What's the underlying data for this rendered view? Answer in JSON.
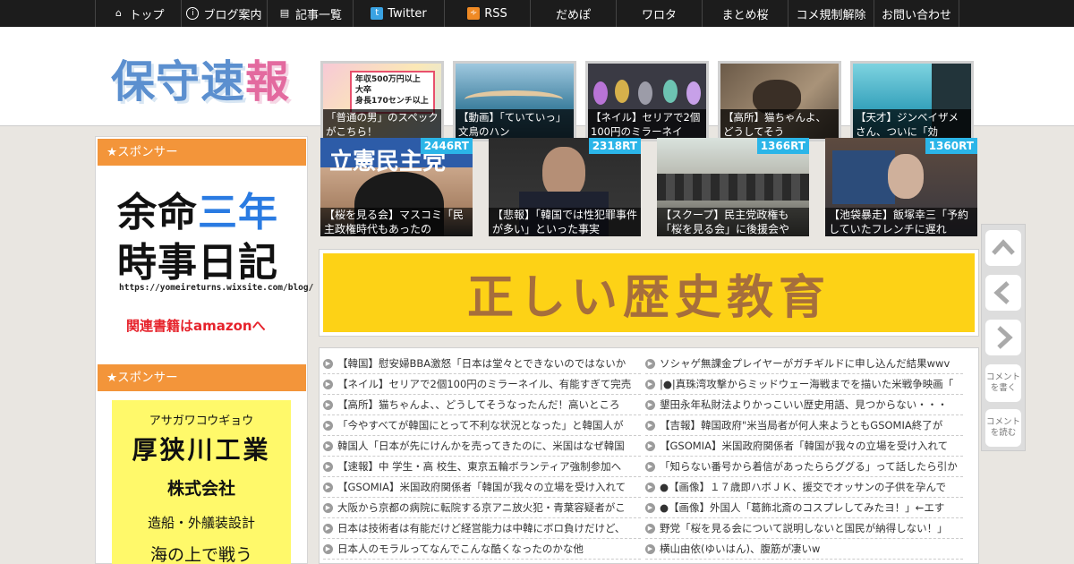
{
  "nav": {
    "items": [
      {
        "label": "トップ",
        "icon": "home-icon"
      },
      {
        "label": "ブログ案内",
        "icon": "info-icon"
      },
      {
        "label": "記事一覧",
        "icon": "list-icon"
      },
      {
        "label": "Twitter",
        "icon": "twitter-icon"
      },
      {
        "label": "RSS",
        "icon": "rss-icon"
      },
      {
        "label": "だめぽ"
      },
      {
        "label": "ワロタ"
      },
      {
        "label": "まとめ桜"
      },
      {
        "label": "コメ規制解除"
      },
      {
        "label": "お問い合わせ"
      }
    ]
  },
  "logo": {
    "text_blue": "保守速",
    "text_pink": "報"
  },
  "header_thumbs": [
    {
      "caption": "「普通の男」のスペックがこちら！",
      "badge_text": "年収500万円以上\n大卒\n身長170センチ以上"
    },
    {
      "caption": "【動画】「ていていっ」文鳥のハン"
    },
    {
      "caption": "【ネイル】セリアで2個100円のミラーネイ"
    },
    {
      "caption": "【高所】猫ちゃんよ、 どうしてそう"
    },
    {
      "caption": "【天才】ジンベイザメさん、ついに「効"
    }
  ],
  "sidebar": {
    "sponsor1_header": "★スポンサー",
    "ad1": {
      "line1a": "余命",
      "line1b": "三年",
      "line2": "時事日記",
      "url": "https://yomeireturns.wixsite.com/blog/",
      "amazon": "関連書籍はamazonへ"
    },
    "sponsor2_header": "★スポンサー",
    "ad2": {
      "kana": "アサガワコウギョウ",
      "name": "厚狭川工業",
      "corp": "株式会社",
      "desc": "造船・外艤装設計",
      "extra": "海の上で戦う"
    }
  },
  "featured": [
    {
      "rt": "2446RT",
      "caption": "【桜を見る会】マスコミ「民主政権時代もあったの"
    },
    {
      "rt": "2318RT",
      "caption": "【悲報】「韓国では性犯罪事件が多い」といった事実"
    },
    {
      "rt": "1366RT",
      "caption": "【スクープ】民主党政権も「桜を見る会」に後援会や"
    },
    {
      "rt": "1360RT",
      "caption": "【池袋暴走】飯塚幸三「予約していたフレンチに遅れ"
    }
  ],
  "banner": {
    "text": "正しい歴史教育"
  },
  "list_left": [
    "【韓国】慰安婦BBA激怒「日本は堂々とできないのではないか",
    "【ネイル】セリアで2個100円のミラーネイル、有能すぎて完売",
    "【高所】猫ちゃんよ、、どうしてそうなったんだ！高いところ",
    "「今やすべてが韓国にとって不利な状況となった」と韓国人が",
    "韓国人「日本が先にけんかを売ってきたのに、米国はなぜ韓国",
    "【速報】中 学生・高 校生、東京五輪ボランティア強制参加へ",
    "【GSOMIA】米国政府関係者「韓国が我々の立場を受け入れて",
    "大阪から京都の病院に転院する京アニ放火犯・青葉容疑者がこ",
    "日本は技術者は有能だけど経営能力は中韓にボロ負けだけど、",
    "日本人のモラルってなんでこんな酷くなったのかな他"
  ],
  "list_right": [
    "ソシャゲ無課金プレイヤーがガチギルドに申し込んだ結果wwv",
    "|●|真珠湾攻撃からミッドウェー海戦までを描いた米戦争映画「",
    "墾田永年私財法よりかっこいい歴史用語、見つからない・・・",
    "【吉報】韓国政府\"米当局者が何人来ようともGSOMIA終了が",
    "【GSOMIA】米国政府関係者「韓国が我々の立場を受け入れて",
    "「知らない番号から着信があったららググる」って話したら引か",
    "●【画像】１７歳即ハボＪＫ、援交でオッサンの子供を孕んで",
    "●【画像】外国人「葛飾北斎のコスプレしてみたヨ！」←エす",
    "野党「桜を見る会について説明しないと国民が納得しない！」",
    "横山由依(ゆいはん)、腹筋が凄いw"
  ],
  "sidebuttons": {
    "write_comment": "コメントを書く",
    "read_comment": "コメントを読む"
  }
}
